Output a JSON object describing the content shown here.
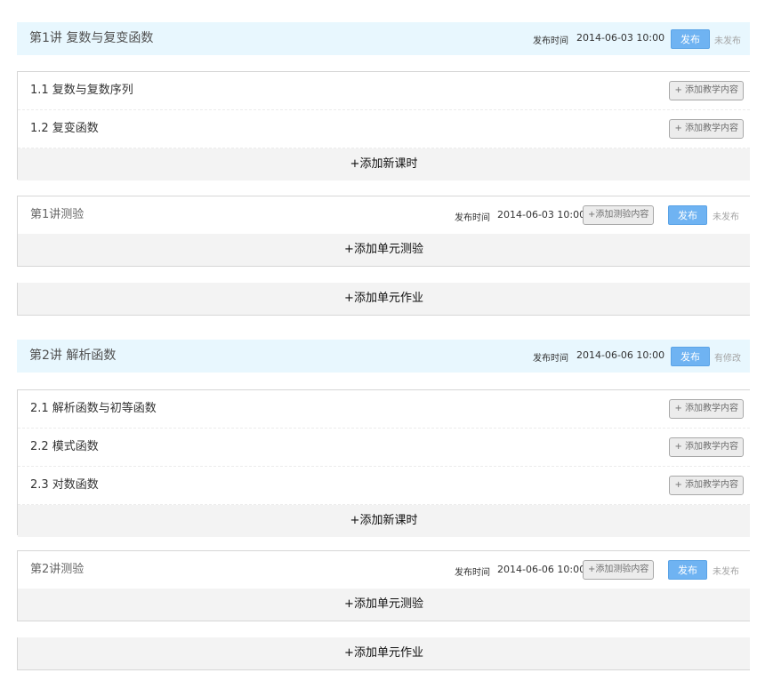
{
  "chapters": [
    {
      "title": "第1讲 复数与复变函数",
      "publish_time_label": "发布时间",
      "publish_time": "2014-06-03 10:00",
      "publish_button": "发布",
      "status": "未发布",
      "lessons": [
        {
          "label": "1.1 复数与复数序列",
          "add_button": "+ 添加教学内容"
        },
        {
          "label": "1.2 复变函数",
          "add_button": "+ 添加教学内容"
        }
      ],
      "add_lesson": "+添加新课时",
      "quiz": {
        "title": "第1讲测验",
        "publish_time_label": "发布时间",
        "publish_time": "2014-06-03 10:00",
        "add_button": "+添加测验内容",
        "publish_button": "发布",
        "status": "未发布",
        "add_quiz": "+添加单元测验"
      },
      "add_homework": "+添加单元作业"
    },
    {
      "title": "第2讲 解析函数",
      "publish_time_label": "发布时间",
      "publish_time": "2014-06-06 10:00",
      "publish_button": "发布",
      "status": "有修改",
      "lessons": [
        {
          "label": "2.1 解析函数与初等函数",
          "add_button": "+ 添加教学内容"
        },
        {
          "label": "2.2 模式函数",
          "add_button": "+ 添加教学内容"
        },
        {
          "label": "2.3 对数函数",
          "add_button": "+ 添加教学内容"
        }
      ],
      "add_lesson": "+添加新课时",
      "quiz": {
        "title": "第2讲测验",
        "publish_time_label": "发布时间",
        "publish_time": "2014-06-06 10:00",
        "add_button": "+添加测验内容",
        "publish_button": "发布",
        "status": "未发布",
        "add_quiz": "+添加单元测验"
      },
      "add_homework": "+添加单元作业"
    }
  ],
  "colors": {
    "header_bg": "#e8f7fe",
    "publish_button_bg": "#6fb3f2",
    "add_bar_bg": "#f3f3f3",
    "status_text": "#a5a5a5"
  }
}
